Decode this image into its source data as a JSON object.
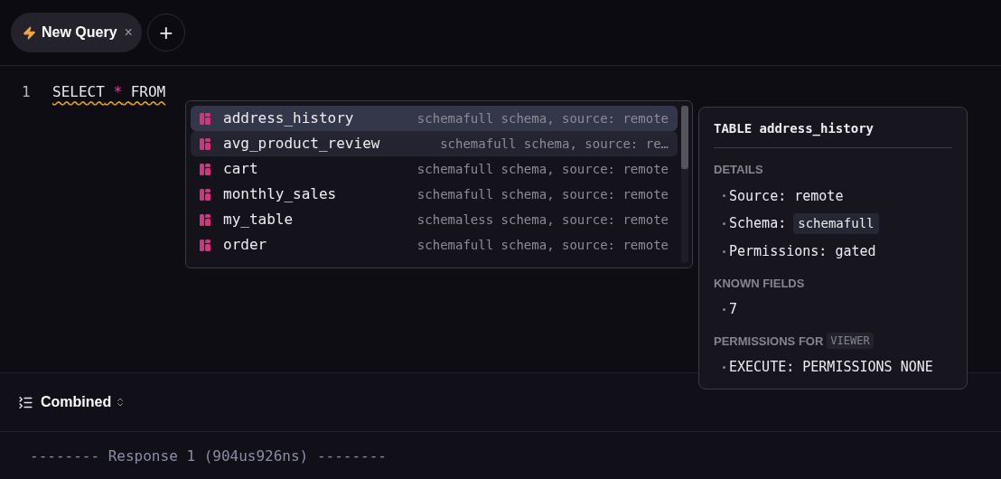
{
  "tabs": [
    {
      "label": "New Query",
      "selected": true,
      "close": "×"
    }
  ],
  "add_tab": "+",
  "editor": {
    "line_number": "1",
    "tokens": [
      {
        "text": "SELECT",
        "kind": "keyword"
      },
      {
        "text": "*",
        "kind": "operator"
      },
      {
        "text": "FROM",
        "kind": "keyword"
      }
    ],
    "warning": true
  },
  "completions": [
    {
      "name": "address_history",
      "detail": "schemafull schema, source: remote",
      "selected": true,
      "hovered": false
    },
    {
      "name": "avg_product_review",
      "detail": "schemafull schema, source: re…",
      "selected": false,
      "hovered": true
    },
    {
      "name": "cart",
      "detail": "schemafull schema, source: remote",
      "selected": false,
      "hovered": false
    },
    {
      "name": "monthly_sales",
      "detail": "schemafull schema, source: remote",
      "selected": false,
      "hovered": false
    },
    {
      "name": "my_table",
      "detail": "schemaless schema, source: remote",
      "selected": false,
      "hovered": false
    },
    {
      "name": "order",
      "detail": "schemafull schema, source: remote",
      "selected": false,
      "hovered": false
    }
  ],
  "details_panel": {
    "title": "TABLE address_history",
    "sections": [
      {
        "heading": "DETAILS",
        "items": [
          {
            "label": "Source: remote"
          },
          {
            "label": "Schema:",
            "chip": "schemafull"
          },
          {
            "label": "Permissions: gated"
          }
        ]
      },
      {
        "heading": "KNOWN FIELDS",
        "items": [
          {
            "label": "7"
          }
        ]
      },
      {
        "heading": "PERMISSIONS FOR",
        "heading_chip": "VIEWER",
        "items": [
          {
            "label": "EXECUTE: PERMISSIONS NONE"
          }
        ]
      }
    ]
  },
  "results": {
    "mode": "Combined",
    "output": "-------- Response 1 (904us926ns) --------"
  }
}
